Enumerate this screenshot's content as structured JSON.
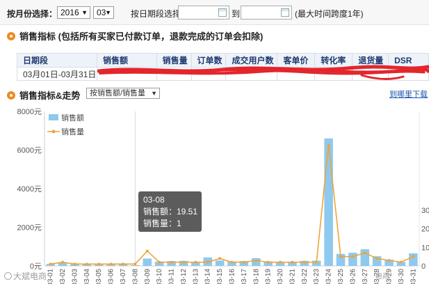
{
  "filters": {
    "month_label": "按月份选择：",
    "year_value": "2016",
    "month_value": "03",
    "period_label": "按日期段选择：",
    "to_label": "到",
    "range_note": "(最大时间跨度1年)",
    "date_from": "",
    "date_to": ""
  },
  "sales_section": {
    "title": "销售指标 (包括所有买家已付款订单，退款完成的订单会扣除)"
  },
  "metrics_table": {
    "headers": [
      "日期段",
      "销售额",
      "销售量",
      "订单数",
      "成交用户数",
      "客单价",
      "转化率",
      "退货量",
      "DSR"
    ],
    "row": [
      "03月01日-03月31日",
      "",
      "",
      "",
      "",
      "",
      "",
      "",
      ""
    ]
  },
  "trend_section": {
    "title": "销售指标&走势",
    "select_value": "按销售额/销售量",
    "link_text": "到哪里下载"
  },
  "chart_data": {
    "type": "bar",
    "categories": [
      "03-01",
      "03-02",
      "03-03",
      "03-04",
      "03-05",
      "03-06",
      "03-07",
      "03-08",
      "03-09",
      "03-10",
      "03-11",
      "03-12",
      "03-13",
      "03-14",
      "03-15",
      "03-16",
      "03-17",
      "03-18",
      "03-19",
      "03-20",
      "03-21",
      "03-22",
      "03-23",
      "03-24",
      "03-25",
      "03-26",
      "03-27",
      "03-28",
      "03-29",
      "03-30",
      "03-31"
    ],
    "series": [
      {
        "name": "销售额",
        "axis": "left",
        "type": "bar",
        "color": "#8ec9ef",
        "values": [
          100,
          170,
          130,
          110,
          120,
          100,
          130,
          19.51,
          380,
          220,
          250,
          260,
          190,
          440,
          280,
          230,
          250,
          400,
          230,
          200,
          190,
          260,
          270,
          6600,
          620,
          680,
          860,
          500,
          320,
          200,
          650
        ]
      },
      {
        "name": "销售量",
        "axis": "right",
        "type": "line",
        "color": "#f0a436",
        "values": [
          1,
          2,
          1,
          1,
          1,
          1,
          1,
          1,
          8,
          2,
          2,
          2,
          2,
          2,
          4,
          2,
          2,
          3,
          2,
          2,
          2,
          2,
          2,
          65,
          5,
          5,
          7,
          4,
          3,
          2,
          5
        ]
      }
    ],
    "y_left": {
      "ticks": [
        "0元",
        "2000元",
        "4000元",
        "6000元",
        "8000元"
      ],
      "max": 8000
    },
    "y_right": {
      "ticks": [
        "0",
        "10",
        "20",
        "30"
      ],
      "max": 83
    },
    "legend_position": "top-left",
    "grid": false
  },
  "tooltip": {
    "date": "03-08",
    "sales_line": "销售额：19.51",
    "qty_line": "销售量：1"
  },
  "watermarks": {
    "left": "大斌电商",
    "right": "电商"
  }
}
